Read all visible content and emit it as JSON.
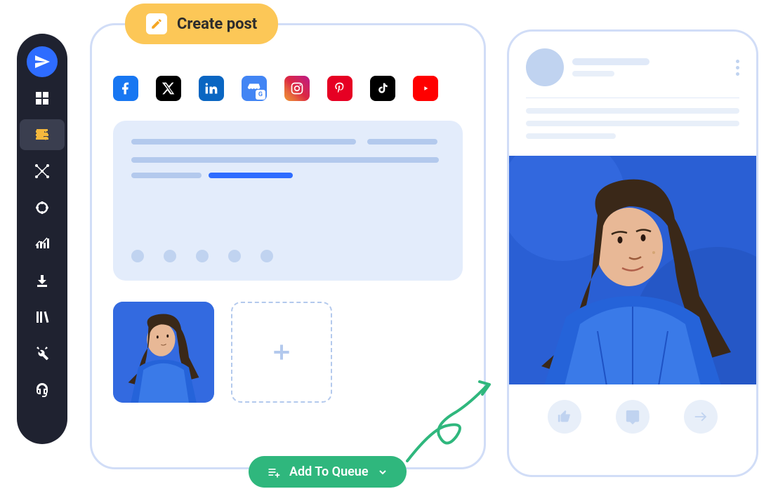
{
  "create_post": {
    "label": "Create post"
  },
  "sidebar": {
    "items": [
      {
        "name": "send-icon"
      },
      {
        "name": "dashboard-icon"
      },
      {
        "name": "compose-icon"
      },
      {
        "name": "network-icon"
      },
      {
        "name": "target-icon"
      },
      {
        "name": "analytics-icon"
      },
      {
        "name": "download-icon"
      },
      {
        "name": "library-icon"
      },
      {
        "name": "tools-icon"
      },
      {
        "name": "support-icon"
      }
    ]
  },
  "social_channels": [
    {
      "name": "facebook"
    },
    {
      "name": "x-twitter"
    },
    {
      "name": "linkedin"
    },
    {
      "name": "google-business"
    },
    {
      "name": "instagram"
    },
    {
      "name": "pinterest"
    },
    {
      "name": "tiktok"
    },
    {
      "name": "youtube"
    }
  ],
  "queue_button": {
    "label": "Add To Queue"
  },
  "media": {
    "thumbnail_description": "woman-blue-jacket",
    "add_label": "add-media"
  },
  "preview": {
    "image_description": "woman-blue-jacket",
    "engagement": [
      "like",
      "comment",
      "share"
    ]
  },
  "colors": {
    "accent_yellow": "#fcc757",
    "accent_green": "#2fb77d",
    "accent_blue": "#2e6cff",
    "panel_border": "#d1ddf7",
    "placeholder": "#b3c9ed"
  }
}
